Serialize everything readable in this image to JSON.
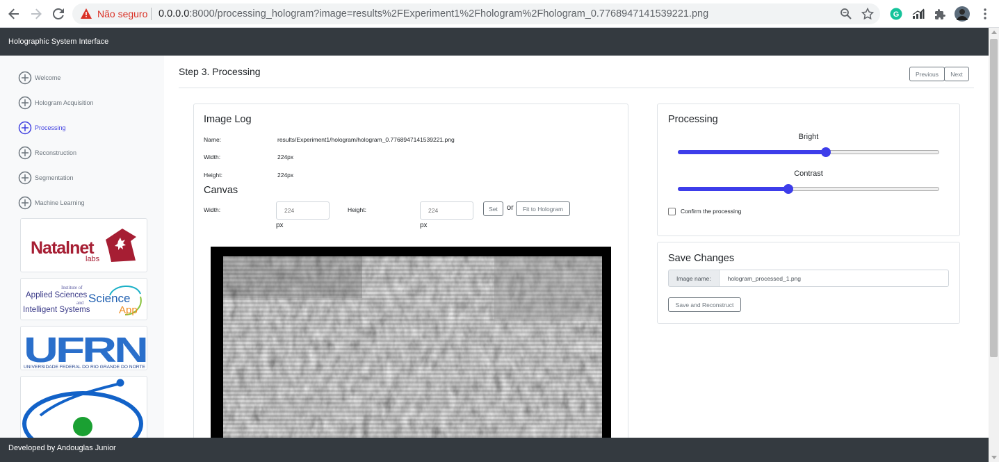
{
  "browser": {
    "security_label": "Não seguro",
    "url_host": "0.0.0.0",
    "url_rest": ":8000/processing_hologram?image=results%2FExperiment1%2Fhologram%2Fhologram_0.7768947141539221.png",
    "extension_icons": [
      "grammarly-icon",
      "signal-bars-icon",
      "puzzle-extensions-icon",
      "profile-avatar"
    ]
  },
  "app": {
    "header_title": "Holographic System Interface",
    "footer_text": "Developed by Andouglas Junior"
  },
  "sidebar": {
    "steps": [
      {
        "label": "Welcome",
        "active": false
      },
      {
        "label": "Hologram Acquisition",
        "active": false
      },
      {
        "label": "Processing",
        "active": true
      },
      {
        "label": "Reconstruction",
        "active": false
      },
      {
        "label": "Segmentation",
        "active": false
      },
      {
        "label": "Machine Learning",
        "active": false
      }
    ],
    "logos": {
      "natalnet_main": "Natalnet",
      "natalnet_sub": "labs",
      "iasis_line1": "Institute of",
      "iasis_line2": "Applied Sciences",
      "iasis_line3": "and",
      "iasis_line4": "Intelligent Systems",
      "science_line1": "Science",
      "science_line2": "App",
      "ufrn_main": "UFRN",
      "ufrn_sub": "UNIVERSIDADE FEDERAL DO RIO GRANDE DO NORTE"
    }
  },
  "main": {
    "step_title": "Step 3. Processing",
    "previous_label": "Previous",
    "next_label": "Next",
    "image_log": {
      "title": "Image Log",
      "name_label": "Name:",
      "name_value": "results/Experiment1/hologram/hologram_0.7768947141539221.png",
      "width_label": "Width:",
      "width_value": "224px",
      "height_label": "Height:",
      "height_value": "224px"
    },
    "canvas": {
      "title": "Canvas",
      "width_label": "Width:",
      "width_placeholder": "224",
      "height_label": "Height:",
      "height_placeholder": "224",
      "unit": "px",
      "set_label": "Set",
      "or_label": "or",
      "fit_label": "Fit to Hologram"
    },
    "processing": {
      "title": "Processing",
      "bright_label": "Bright",
      "bright_fraction": 0.57,
      "contrast_label": "Contrast",
      "contrast_fraction": 0.42,
      "accent_color": "#3d3dea",
      "confirm_label": "Confirm the processing",
      "confirm_checked": false
    },
    "save": {
      "title": "Save Changes",
      "image_name_label": "Image name:",
      "image_name_value": "hologram_processed_1.png",
      "save_button_label": "Save and Reconstruct"
    }
  }
}
